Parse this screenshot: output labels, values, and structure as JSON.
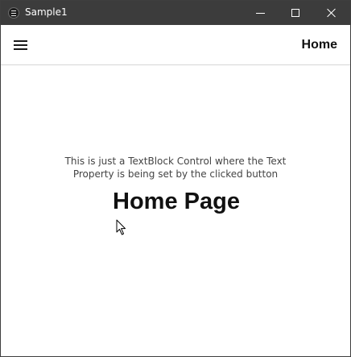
{
  "window": {
    "title": "Sample1",
    "app_icon": "app-menu-icon",
    "controls": {
      "minimize_icon": "minimize-icon",
      "maximize_icon": "maximize-icon",
      "close_icon": "close-icon"
    }
  },
  "appbar": {
    "menu_icon": "hamburger-icon",
    "title": "Home"
  },
  "content": {
    "description": "This is just a TextBlock Control where the Text Property is being set by the clicked button",
    "heading": "Home Page"
  },
  "colors": {
    "titlebar_bg": "#3c3c3c",
    "titlebar_text": "#ffffff",
    "content_bg": "#ffffff",
    "header_text": "#111111",
    "body_text": "#444444"
  }
}
